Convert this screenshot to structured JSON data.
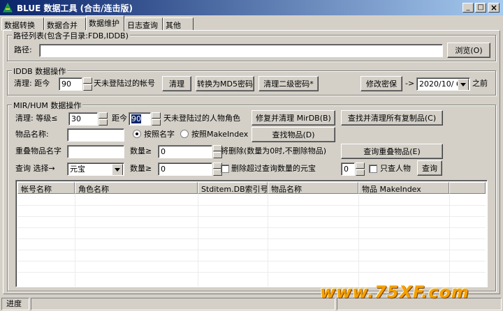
{
  "window": {
    "title": "BLUE 数据工具 (合击/连击版)",
    "minimize": "_",
    "maximize": "□",
    "close": "×"
  },
  "tabs": [
    {
      "label": "数据转换"
    },
    {
      "label": "数据合并"
    },
    {
      "label": "数据维护"
    },
    {
      "label": "日志查询"
    },
    {
      "label": "其他"
    }
  ],
  "path_group": {
    "title": "路径列表(包含子目录:FDB,IDDB)",
    "path_label": "路径:",
    "path_value": "",
    "browse_button": "浏览(O)"
  },
  "iddb_group": {
    "title": "IDDB 数据操作",
    "clean_label": "清理: 距今",
    "days_value": "90",
    "days_suffix": "天未登陆过的帐号",
    "clean_button": "清理",
    "md5_button": "转换为MD5密码",
    "clear_pwd2_button": "清理二级密码*",
    "modify_pwd_button": "修改密保",
    "arrow": "->",
    "date_value": "2020/10/ 6",
    "before_label": "之前"
  },
  "mir_group": {
    "title": "MIR/HUM 数据操作",
    "clean_level_label": "清理: 等级≤",
    "level_value": "30",
    "distance_label": "距今",
    "distance_value": "90",
    "distance_suffix": "天未登陆过的人物角色",
    "repair_button": "修复并清理 MirDB(B)",
    "find_copies_button": "查找并清理所有复制品(C)",
    "item_name_label": "物品名称:",
    "item_name_value": "",
    "radio_by_name": "按照名字",
    "radio_by_makeindex": "按照MakeIndex",
    "find_item_button": "查找物品(D)",
    "stack_name_label": "重叠物品名字",
    "stack_name_value": "",
    "qty_label": "数量≥",
    "qty_value": "0",
    "delete_note": "将删除(数量为0时,不删除物品)",
    "query_stack_button": "查询重叠物品(E)",
    "query_label": "查询 选择→",
    "query_select_value": "元宝",
    "qty_label2": "数量≥",
    "qty_value2": "0",
    "delete_over_label": "删除超过查询数量的元宝",
    "small_value": "0",
    "only_char_label": "只查人物",
    "query_button": "查询"
  },
  "table": {
    "columns": [
      "帐号名称",
      "角色名称",
      "Stditem.DB索引号",
      "物品名称",
      "物品 MakeIndex"
    ],
    "rows": []
  },
  "status": {
    "progress_label": "进度"
  },
  "watermark": {
    "text": "www.75XF.com"
  },
  "colors": {
    "titlebar_start": "#0a246a",
    "titlebar_end": "#a6caf0",
    "face": "#d4d0c8",
    "watermark": "#f5a000"
  }
}
